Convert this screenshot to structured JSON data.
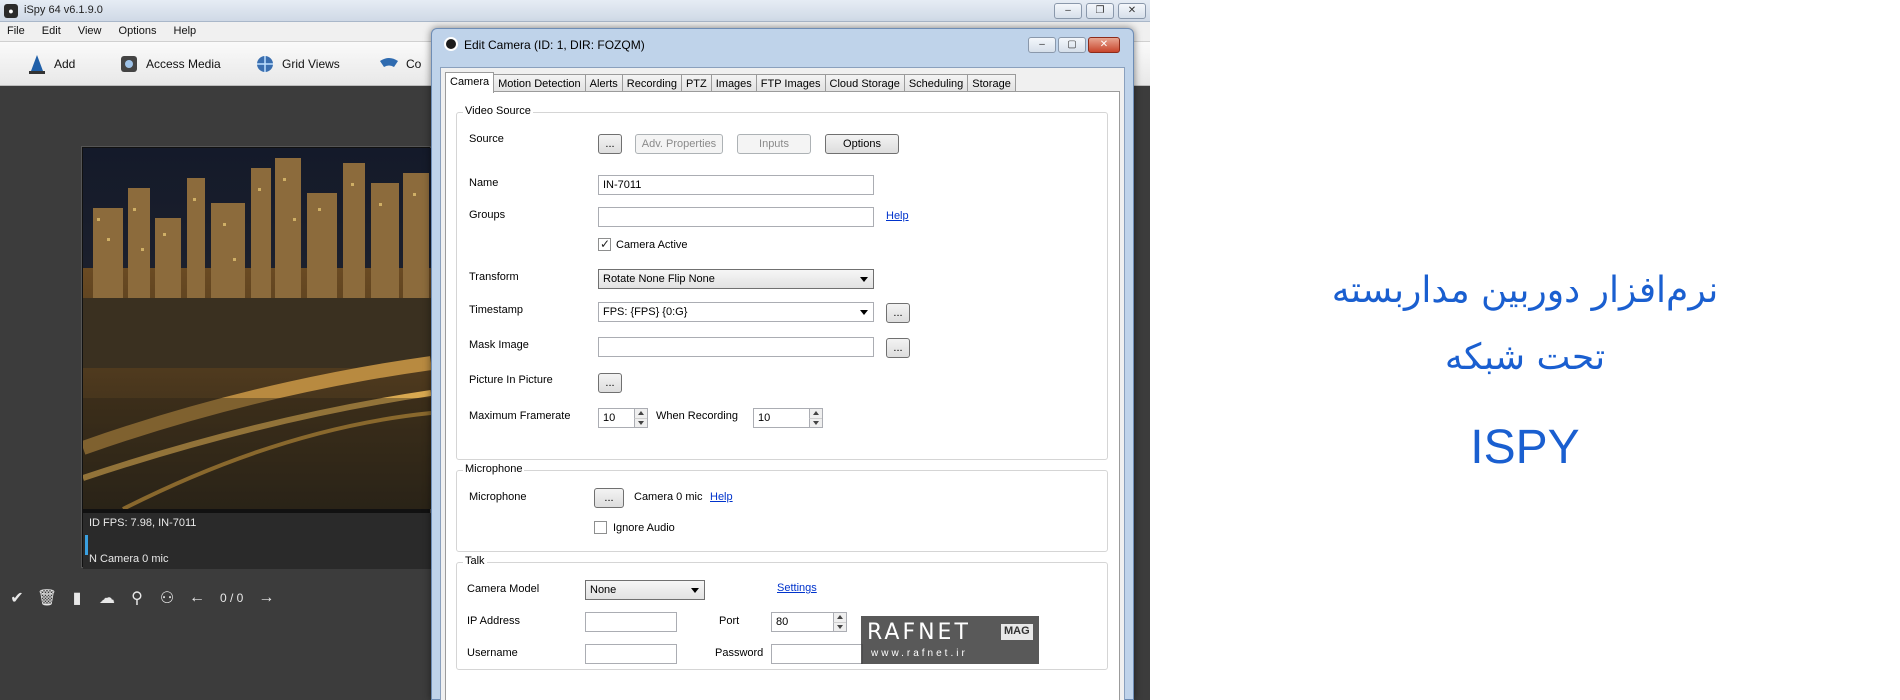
{
  "main": {
    "title": "iSpy 64 v6.1.9.0",
    "menu": [
      "File",
      "Edit",
      "View",
      "Options",
      "Help"
    ],
    "toolbar": {
      "add": "Add",
      "access_media": "Access Media",
      "grid_views": "Grid Views",
      "cut": "Co"
    },
    "camera_tile": {
      "status_line": "ID  FPS: 7.98, IN-7011",
      "mic_line": "N  Camera 0 mic"
    },
    "page_counter": "0 / 0"
  },
  "dialog": {
    "title": "Edit Camera (ID: 1, DIR: FOZQM)",
    "tabs": [
      "Camera",
      "Motion Detection",
      "Alerts",
      "Recording",
      "PTZ",
      "Images",
      "FTP Images",
      "Cloud Storage",
      "Scheduling",
      "Storage"
    ],
    "video_source": {
      "legend": "Video Source",
      "source_label": "Source",
      "browse": "...",
      "adv_properties": "Adv. Properties",
      "inputs": "Inputs",
      "options": "Options",
      "name_label": "Name",
      "name_value": "IN-7011",
      "groups_label": "Groups",
      "groups_value": "",
      "help": "Help",
      "camera_active": "Camera Active",
      "transform_label": "Transform",
      "transform_value": "Rotate None Flip None",
      "timestamp_label": "Timestamp",
      "timestamp_value": "FPS: {FPS} {0:G}",
      "mask_label": "Mask Image",
      "mask_value": "",
      "pip_label": "Picture In Picture",
      "max_framerate_label": "Maximum Framerate",
      "max_framerate_value": "10",
      "when_recording_label": "When Recording",
      "when_recording_value": "10"
    },
    "microphone": {
      "legend": "Microphone",
      "label": "Microphone",
      "browse": "...",
      "value": "Camera 0 mic",
      "help": "Help",
      "ignore_audio": "Ignore Audio"
    },
    "talk": {
      "legend": "Talk",
      "camera_model_label": "Camera Model",
      "camera_model_value": "None",
      "settings": "Settings",
      "ip_label": "IP Address",
      "ip_value": "",
      "port_label": "Port",
      "port_value": "80",
      "username_label": "Username",
      "username_value": "",
      "password_label": "Password",
      "password_value": ""
    }
  },
  "promo": {
    "line1": "نرم‌افزار دوربین مداربسته",
    "line2": "تحت شبکه",
    "line3": "ISPY",
    "color": "#1a5fd0"
  },
  "watermark": {
    "main": "RAFNET",
    "mag": "MAG",
    "url": "www.rafnet.ir"
  }
}
